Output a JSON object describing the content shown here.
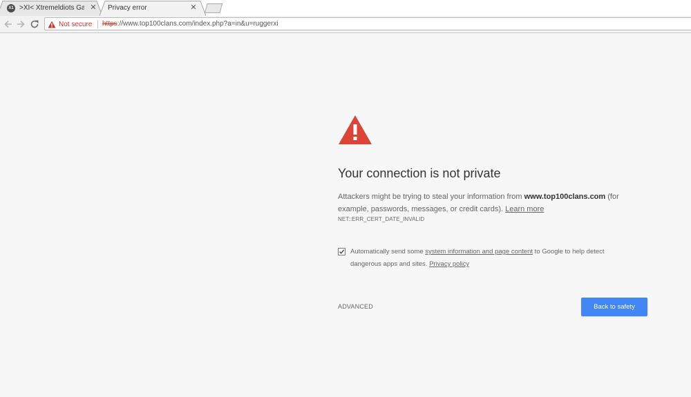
{
  "tabs": [
    {
      "favicon_text": "X1",
      "title": ">XI< Xtremeldiots Gam",
      "close": "✕"
    },
    {
      "title": "Privacy error",
      "close": "✕"
    }
  ],
  "toolbar": {
    "security_label": "Not secure",
    "url_scheme": "https",
    "url_host": "://www.top100clans.com",
    "url_path": "/index.php?a=in&u=ruggerxi"
  },
  "interstitial": {
    "heading": "Your connection is not private",
    "explanation_prefix": "Attackers might be trying to steal your information from ",
    "explanation_host": "www.top100clans.com",
    "explanation_suffix": " (for example, passwords, messages, or credit cards). ",
    "learn_more": "Learn more",
    "error_code": "NET::ERR_CERT_DATE_INVALID",
    "optin_prefix": "Automatically send some ",
    "optin_link": "system information and page content",
    "optin_middle": " to Google to help detect dangerous apps and sites. ",
    "optin_privacy": "Privacy policy",
    "optin_checked": true,
    "advanced_label": "ADVANCED",
    "back_label": "Back to safety"
  },
  "colors": {
    "page_bg": "#f7f7f7",
    "warning_red": "#db4437",
    "not_secure_red": "#c53929",
    "primary_button": "#4285f4"
  }
}
